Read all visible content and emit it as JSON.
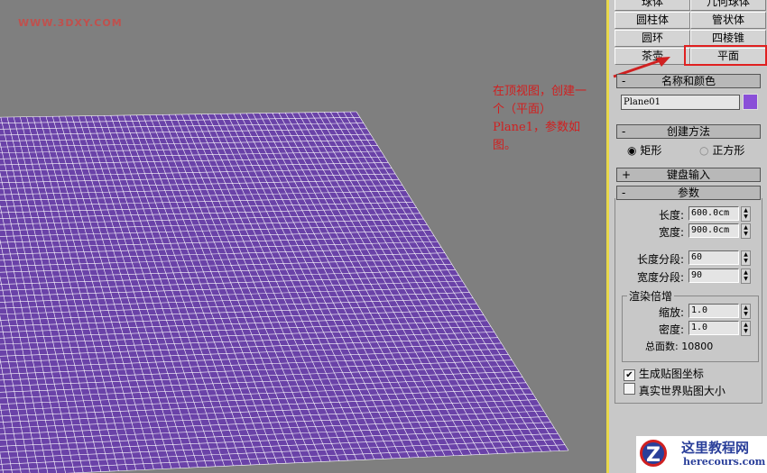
{
  "watermark": "WWW.3DXY.COM",
  "annotation": "在顶视图，创建一个（平面）Plane1，参数如图。",
  "object_types": [
    "球体",
    "几何球体",
    "圆柱体",
    "管状体",
    "圆环",
    "四棱锥",
    "茶壶",
    "平面"
  ],
  "selected_type": "平面",
  "name_color": {
    "title": "名称和颜色",
    "toggle": "-",
    "name": "Plane01",
    "color": "#8a4fd8"
  },
  "creation": {
    "title": "创建方法",
    "toggle": "-",
    "options": [
      "矩形",
      "正方形"
    ],
    "selected": "矩形"
  },
  "keyboard": {
    "title": "键盘输入",
    "toggle": "+"
  },
  "params": {
    "title": "参数",
    "toggle": "-",
    "length_label": "长度:",
    "length": "600.0cm",
    "width_label": "宽度:",
    "width": "900.0cm",
    "lsegs_label": "长度分段:",
    "lsegs": "60",
    "wsegs_label": "宽度分段:",
    "wsegs": "90",
    "render_title": "渲染倍增",
    "scale_label": "缩放:",
    "scale": "1.0",
    "density_label": "密度:",
    "density": "1.0",
    "faces_label": "总面数:",
    "faces": "10800",
    "gen_map": "生成贴图坐标",
    "gen_map_checked": true,
    "real_world": "真实世界贴图大小",
    "real_world_checked": false
  },
  "logo": {
    "title": "这里教程网",
    "url": "herecours.com"
  },
  "colors": {
    "plane": "#6a42a8",
    "grid": "#ffffff",
    "highlight": "#e02020"
  }
}
